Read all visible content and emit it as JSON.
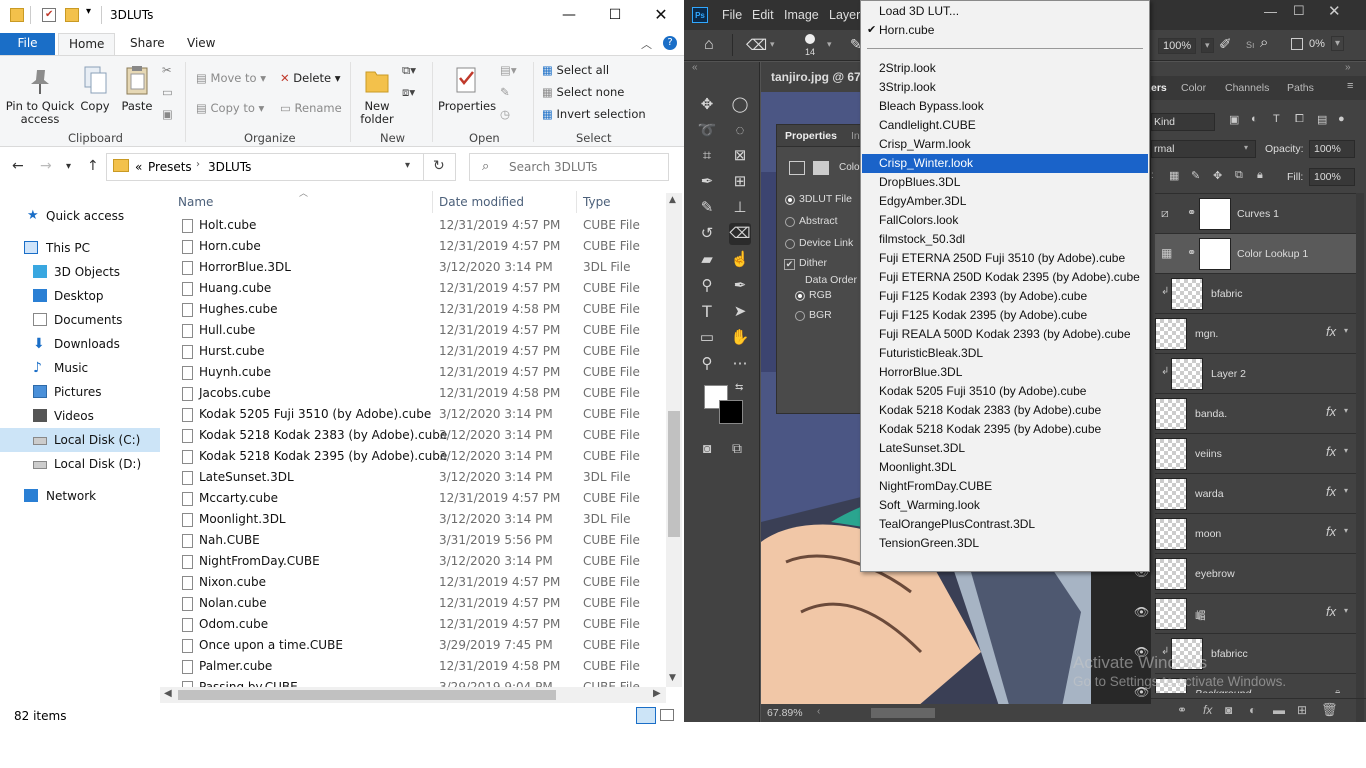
{
  "explorer": {
    "title": "3DLUTs",
    "tabs": {
      "file": "File",
      "home": "Home",
      "share": "Share",
      "view": "View"
    },
    "ribbon": {
      "clipboard": {
        "pin": "Pin to Quick access",
        "copy": "Copy",
        "paste": "Paste",
        "label": "Clipboard"
      },
      "organize": {
        "move_to": "Move to",
        "copy_to": "Copy to",
        "delete": "Delete",
        "rename": "Rename",
        "label": "Organize"
      },
      "new": {
        "new_folder": "New folder",
        "label": "New"
      },
      "open": {
        "properties": "Properties",
        "label": "Open"
      },
      "select": {
        "select_all": "Select all",
        "select_none": "Select none",
        "invert": "Invert selection",
        "label": "Select"
      }
    },
    "breadcrumb": {
      "chevrons": "«",
      "part1": "Presets",
      "part2": "3DLUTs"
    },
    "search_placeholder": "Search 3DLUTs",
    "nav": [
      "Quick access",
      "This PC",
      "3D Objects",
      "Desktop",
      "Documents",
      "Downloads",
      "Music",
      "Pictures",
      "Videos",
      "Local Disk (C:)",
      "Local Disk (D:)",
      "Network"
    ],
    "columns": {
      "name": "Name",
      "date": "Date modified",
      "type": "Type"
    },
    "files": [
      {
        "name": "Holt.cube",
        "date": "12/31/2019 4:57 PM",
        "type": "CUBE File"
      },
      {
        "name": "Horn.cube",
        "date": "12/31/2019 4:57 PM",
        "type": "CUBE File"
      },
      {
        "name": "HorrorBlue.3DL",
        "date": "3/12/2020 3:14 PM",
        "type": "3DL File"
      },
      {
        "name": "Huang.cube",
        "date": "12/31/2019 4:57 PM",
        "type": "CUBE File"
      },
      {
        "name": "Hughes.cube",
        "date": "12/31/2019 4:58 PM",
        "type": "CUBE File"
      },
      {
        "name": "Hull.cube",
        "date": "12/31/2019 4:57 PM",
        "type": "CUBE File"
      },
      {
        "name": "Hurst.cube",
        "date": "12/31/2019 4:57 PM",
        "type": "CUBE File"
      },
      {
        "name": "Huynh.cube",
        "date": "12/31/2019 4:57 PM",
        "type": "CUBE File"
      },
      {
        "name": "Jacobs.cube",
        "date": "12/31/2019 4:58 PM",
        "type": "CUBE File"
      },
      {
        "name": "Kodak 5205 Fuji 3510 (by Adobe).cube",
        "date": "3/12/2020 3:14 PM",
        "type": "CUBE File"
      },
      {
        "name": "Kodak 5218 Kodak 2383 (by Adobe).cube",
        "date": "3/12/2020 3:14 PM",
        "type": "CUBE File"
      },
      {
        "name": "Kodak 5218 Kodak 2395 (by Adobe).cube",
        "date": "3/12/2020 3:14 PM",
        "type": "CUBE File"
      },
      {
        "name": "LateSunset.3DL",
        "date": "3/12/2020 3:14 PM",
        "type": "3DL File"
      },
      {
        "name": "Mccarty.cube",
        "date": "12/31/2019 4:57 PM",
        "type": "CUBE File"
      },
      {
        "name": "Moonlight.3DL",
        "date": "3/12/2020 3:14 PM",
        "type": "3DL File"
      },
      {
        "name": "Nah.CUBE",
        "date": "3/31/2019 5:56 PM",
        "type": "CUBE File"
      },
      {
        "name": "NightFromDay.CUBE",
        "date": "3/12/2020 3:14 PM",
        "type": "CUBE File"
      },
      {
        "name": "Nixon.cube",
        "date": "12/31/2019 4:57 PM",
        "type": "CUBE File"
      },
      {
        "name": "Nolan.cube",
        "date": "12/31/2019 4:57 PM",
        "type": "CUBE File"
      },
      {
        "name": "Odom.cube",
        "date": "12/31/2019 4:57 PM",
        "type": "CUBE File"
      },
      {
        "name": "Once upon a time.CUBE",
        "date": "3/29/2019 7:45 PM",
        "type": "CUBE File"
      },
      {
        "name": "Palmer.cube",
        "date": "12/31/2019 4:58 PM",
        "type": "CUBE File"
      },
      {
        "name": "Passing by.CUBE",
        "date": "3/29/2019 9:04 PM",
        "type": "CUBE File"
      }
    ],
    "status": "82 items"
  },
  "photoshop": {
    "menus": [
      "File",
      "Edit",
      "Image",
      "Layer"
    ],
    "doc_tab": "tanjiro.jpg @ 67.9",
    "brush_size": "14",
    "zoom_top": "100%",
    "opacity_top": "0%",
    "zoom_status": "67.89%",
    "properties": {
      "title": "Properties",
      "tab2": "In",
      "color_label": "Colo",
      "options": [
        "3DLUT File",
        "Abstract",
        "Device Link"
      ],
      "dither": "Dither",
      "data_order": "Data Order",
      "rgb": "RGB",
      "bgr": "BGR"
    },
    "panel_tabs": [
      "ers",
      "Color",
      "Channels",
      "Paths"
    ],
    "kind": "Kind",
    "blend": "rmal",
    "opacity_label": "Opacity:",
    "opacity": "100%",
    "fill_label": "Fill:",
    "fill": "100%",
    "layers": [
      {
        "name": "Curves 1",
        "fx": false
      },
      {
        "name": "Color Lookup 1",
        "fx": false
      },
      {
        "name": "bfabric",
        "fx": false
      },
      {
        "name": "mgn.",
        "fx": true
      },
      {
        "name": "Layer 2",
        "fx": false
      },
      {
        "name": "banda.",
        "fx": true
      },
      {
        "name": "veiins",
        "fx": true
      },
      {
        "name": "warda",
        "fx": true
      },
      {
        "name": "moon",
        "fx": true
      },
      {
        "name": "eyebrow",
        "fx": false
      },
      {
        "name": "嵋",
        "fx": true
      },
      {
        "name": "bfabricc",
        "fx": false
      },
      {
        "name": "Background",
        "fx": false
      }
    ],
    "watermark": {
      "line1": "Activate Windows",
      "line2": "Go to Settings to activate Windows."
    }
  },
  "lut_menu": {
    "load": "Load 3D LUT...",
    "checked": "Horn.cube",
    "items": [
      "2Strip.look",
      "3Strip.look",
      "Bleach Bypass.look",
      "Candlelight.CUBE",
      "Crisp_Warm.look",
      "Crisp_Winter.look",
      "DropBlues.3DL",
      "EdgyAmber.3DL",
      "FallColors.look",
      "filmstock_50.3dl",
      "Fuji ETERNA 250D Fuji 3510 (by Adobe).cube",
      "Fuji ETERNA 250D Kodak 2395 (by Adobe).cube",
      "Fuji F125 Kodak 2393 (by Adobe).cube",
      "Fuji F125 Kodak 2395 (by Adobe).cube",
      "Fuji REALA 500D Kodak 2393 (by Adobe).cube",
      "FuturisticBleak.3DL",
      "HorrorBlue.3DL",
      "Kodak 5205 Fuji 3510 (by Adobe).cube",
      "Kodak 5218 Kodak 2383 (by Adobe).cube",
      "Kodak 5218 Kodak 2395 (by Adobe).cube",
      "LateSunset.3DL",
      "Moonlight.3DL",
      "NightFromDay.CUBE",
      "Soft_Warming.look",
      "TealOrangePlusContrast.3DL",
      "TensionGreen.3DL"
    ],
    "highlighted": "Crisp_Winter.look"
  },
  "colors": {
    "accent": "#1a6ec7",
    "menu_highlight": "#1a63c9",
    "ps_bg": "#535353"
  }
}
